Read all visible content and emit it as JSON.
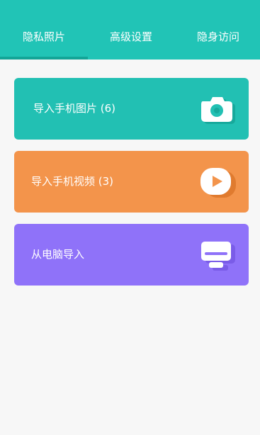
{
  "tabs": [
    {
      "label": "隐私照片"
    },
    {
      "label": "高级设置"
    },
    {
      "label": "隐身访问"
    }
  ],
  "active_tab": 0,
  "cards": [
    {
      "label": "导入手机图片 (6)",
      "icon": "camera-icon",
      "color": "#22c0b3"
    },
    {
      "label": "导入手机视频 (3)",
      "icon": "video-icon",
      "color": "#f3944b"
    },
    {
      "label": "从电脑导入",
      "icon": "monitor-icon",
      "color": "#8f72f9"
    }
  ],
  "colors": {
    "header": "#21c4b6",
    "tab_indicator": "#13a597",
    "background": "#f7f7f7"
  }
}
